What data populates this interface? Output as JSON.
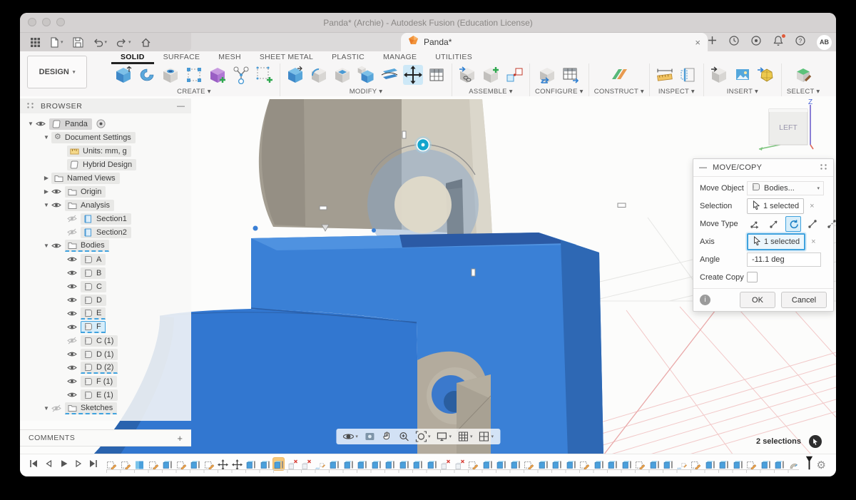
{
  "glyphs": {
    "caret": "▾",
    "minus": "—",
    "close": "×",
    "plus": "+",
    "gear": "⚙"
  },
  "colors": {
    "accent": "#3fa2de",
    "body_blue": "#3a7fd5",
    "head_tan": "#c9c4b6",
    "timeline_highlight": "#f6c87a",
    "selection_fill": "#d6edfa"
  },
  "window": {
    "title": "Panda* (Archie) - Autodesk Fusion (Education License)"
  },
  "document_tab": {
    "label": "Panda*"
  },
  "top_right": {
    "avatar": "AB"
  },
  "design_button": {
    "label": "DESIGN"
  },
  "ribbon": {
    "tabs": [
      {
        "label": "SOLID",
        "active": true
      },
      {
        "label": "SURFACE",
        "active": false
      },
      {
        "label": "MESH",
        "active": false
      },
      {
        "label": "SHEET METAL",
        "active": false
      },
      {
        "label": "PLASTIC",
        "active": false
      },
      {
        "label": "MANAGE",
        "active": false
      },
      {
        "label": "UTILITIES",
        "active": false
      }
    ],
    "groups": [
      {
        "label": "CREATE",
        "icons": [
          {
            "n": "extrude"
          },
          {
            "n": "revolve"
          },
          {
            "n": "hole"
          },
          {
            "n": "rect-pattern"
          },
          {
            "n": "form"
          },
          {
            "n": "pattern"
          },
          {
            "n": "create-sketch"
          }
        ]
      },
      {
        "label": "MODIFY",
        "icons": [
          {
            "n": "press-pull"
          },
          {
            "n": "fillet"
          },
          {
            "n": "shell"
          },
          {
            "n": "combine"
          },
          {
            "n": "split"
          },
          {
            "n": "move",
            "hl": true
          },
          {
            "n": "params"
          }
        ]
      },
      {
        "label": "ASSEMBLE",
        "icons": [
          {
            "n": "insert"
          },
          {
            "n": "new-component"
          },
          {
            "n": "joint"
          }
        ]
      },
      {
        "label": "CONFIGURE",
        "icons": [
          {
            "n": "configuration"
          },
          {
            "n": "config-table"
          }
        ]
      },
      {
        "label": "CONSTRUCT",
        "icons": [
          {
            "n": "plane"
          }
        ]
      },
      {
        "label": "INSPECT",
        "icons": [
          {
            "n": "measure"
          },
          {
            "n": "section-analysis"
          }
        ]
      },
      {
        "label": "INSERT",
        "icons": [
          {
            "n": "derive"
          },
          {
            "n": "canvas"
          },
          {
            "n": "insert-mesh"
          }
        ]
      },
      {
        "label": "SELECT",
        "icons": [
          {
            "n": "select"
          }
        ]
      }
    ]
  },
  "browser": {
    "title": "BROWSER",
    "tree": [
      {
        "label": "Panda",
        "indent": 0,
        "exp": "open",
        "eye": "on",
        "icon": "component",
        "radio": true,
        "chip": "grey"
      },
      {
        "label": "Document Settings",
        "indent": 1,
        "exp": "open",
        "icon": "gear"
      },
      {
        "label": "Units: mm, g",
        "indent": 2,
        "icon": "ruler"
      },
      {
        "label": "Hybrid Design",
        "indent": 2,
        "icon": "component"
      },
      {
        "label": "Named Views",
        "indent": 1,
        "exp": "closed",
        "icon": "folder"
      },
      {
        "label": "Origin",
        "indent": 1,
        "exp": "closed",
        "eye": "on",
        "icon": "folder"
      },
      {
        "label": "Analysis",
        "indent": 1,
        "exp": "open",
        "eye": "on",
        "icon": "folder"
      },
      {
        "label": "Section1",
        "indent": 2,
        "eye": "off",
        "icon": "section"
      },
      {
        "label": "Section2",
        "indent": 2,
        "eye": "off",
        "icon": "section"
      },
      {
        "label": "Bodies",
        "indent": 1,
        "exp": "open",
        "eye": "on",
        "icon": "folder",
        "dashed": true
      },
      {
        "label": "A",
        "indent": 2,
        "eye": "on",
        "icon": "body"
      },
      {
        "label": "B",
        "indent": 2,
        "eye": "on",
        "icon": "body"
      },
      {
        "label": "C",
        "indent": 2,
        "eye": "on",
        "icon": "body"
      },
      {
        "label": "D",
        "indent": 2,
        "eye": "on",
        "icon": "body"
      },
      {
        "label": "E",
        "indent": 2,
        "eye": "on",
        "icon": "body",
        "dashed": true
      },
      {
        "label": "F",
        "indent": 2,
        "eye": "on",
        "icon": "body",
        "dashed": true,
        "chip": "selected"
      },
      {
        "label": "C (1)",
        "indent": 2,
        "eye": "off",
        "icon": "body"
      },
      {
        "label": "D (1)",
        "indent": 2,
        "eye": "on",
        "icon": "body"
      },
      {
        "label": "D (2)",
        "indent": 2,
        "eye": "on",
        "icon": "body",
        "dashed": true
      },
      {
        "label": "F (1)",
        "indent": 2,
        "eye": "on",
        "icon": "body"
      },
      {
        "label": "E (1)",
        "indent": 2,
        "eye": "on",
        "icon": "body"
      },
      {
        "label": "Sketches",
        "indent": 1,
        "exp": "open",
        "eye": "off",
        "icon": "folder",
        "dashed": true
      }
    ],
    "comments": {
      "label": "COMMENTS",
      "add": "+"
    }
  },
  "viewcube": {
    "face": "LEFT",
    "z_label": "Z"
  },
  "dialog": {
    "title": "MOVE/COPY",
    "move_object": {
      "label": "Move Object",
      "value": "Bodies..."
    },
    "selection": {
      "label": "Selection",
      "value": "1 selected"
    },
    "move_type": {
      "label": "Move Type",
      "options": [
        "free-move",
        "translate",
        "rotate",
        "point-to-point",
        "point-to-position"
      ],
      "selected": "rotate"
    },
    "axis": {
      "label": "Axis",
      "value": "1 selected"
    },
    "angle": {
      "label": "Angle",
      "value": "-11.1 deg"
    },
    "create_copy": {
      "label": "Create Copy",
      "checked": false
    },
    "ok": "OK",
    "cancel": "Cancel"
  },
  "navbar": {
    "items": [
      {
        "name": "orbit",
        "caret": true
      },
      {
        "name": "look-at",
        "caret": false
      },
      {
        "name": "pan",
        "caret": false
      },
      {
        "name": "zoom",
        "caret": false
      },
      {
        "name": "fit",
        "caret": true
      },
      {
        "name": "display",
        "caret": true
      },
      {
        "name": "grid",
        "caret": true
      },
      {
        "name": "viewports",
        "caret": true
      }
    ]
  },
  "status": {
    "selections": "2 selections"
  },
  "timeline": {
    "active_index": 12,
    "marked_indices": [
      15,
      41
    ],
    "features": [
      "sketch",
      "sketch",
      "form",
      "sketch",
      "solid",
      "sketch",
      "solid",
      "sketch",
      "move",
      "move",
      "solid",
      "solid",
      "solid",
      "suppressed",
      "suppressed",
      "sketch",
      "solid",
      "solid",
      "solid",
      "solid",
      "solid",
      "solid",
      "solid",
      "solid",
      "suppressed",
      "suppressed",
      "sketch",
      "solid",
      "solid",
      "solid",
      "sketch",
      "solid",
      "solid",
      "solid",
      "sketch",
      "solid",
      "solid",
      "solid",
      "sketch",
      "solid",
      "solid",
      "sketch",
      "sketch",
      "solid",
      "solid",
      "solid",
      "sketch",
      "solid",
      "solid",
      "revolve"
    ]
  }
}
